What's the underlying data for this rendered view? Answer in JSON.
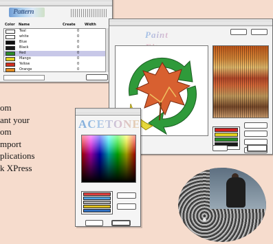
{
  "window_list": {
    "buttons": [
      "",
      ""
    ],
    "headers": {
      "color": "Color",
      "name": "Name",
      "create": "Create",
      "width": "Width"
    },
    "rows": [
      {
        "name": "Teal",
        "create": "0",
        "swatch": "#ffffff"
      },
      {
        "name": "white",
        "create": "0",
        "swatch": "#ffffff"
      },
      {
        "name": "Blue",
        "create": "0",
        "swatch": "#111111"
      },
      {
        "name": "Black",
        "create": "0",
        "swatch": "#1a1a1a"
      },
      {
        "name": "Red",
        "create": "0",
        "swatch": "#2b8a2b"
      },
      {
        "name": "Mango",
        "create": "0",
        "swatch": "#e0d020"
      },
      {
        "name": "Yellow",
        "create": "0",
        "swatch": "#d03020"
      },
      {
        "name": "Orange",
        "create": "0",
        "swatch": "#e08a20"
      }
    ],
    "status": "",
    "ok": ""
  },
  "window_paint": {
    "logo": "Paint Fitness",
    "palette_swatches": [
      "#d02020",
      "#e0d020",
      "#2a8a2a",
      "#1a1a1a"
    ],
    "side_buttons": [
      "",
      "",
      "",
      ""
    ],
    "footer_text": "",
    "ok_label": ""
  },
  "window_acetone": {
    "title": "",
    "logo": "ACETONE",
    "palette_label": "",
    "swatches": [
      "#e04040",
      "#50a0e0",
      "#b0b0b0",
      "#e0c020",
      "#3070c0"
    ],
    "edit_label": "",
    "new_label": "",
    "cancel_label": "",
    "ok_label": ""
  },
  "body_copy": {
    "lines": [
      "om",
      "ant your",
      "om",
      "mport",
      "plications",
      "k XPress"
    ]
  },
  "colors": {
    "page_bg": "#f6dccd",
    "window_bg": "#f3f3f3"
  }
}
